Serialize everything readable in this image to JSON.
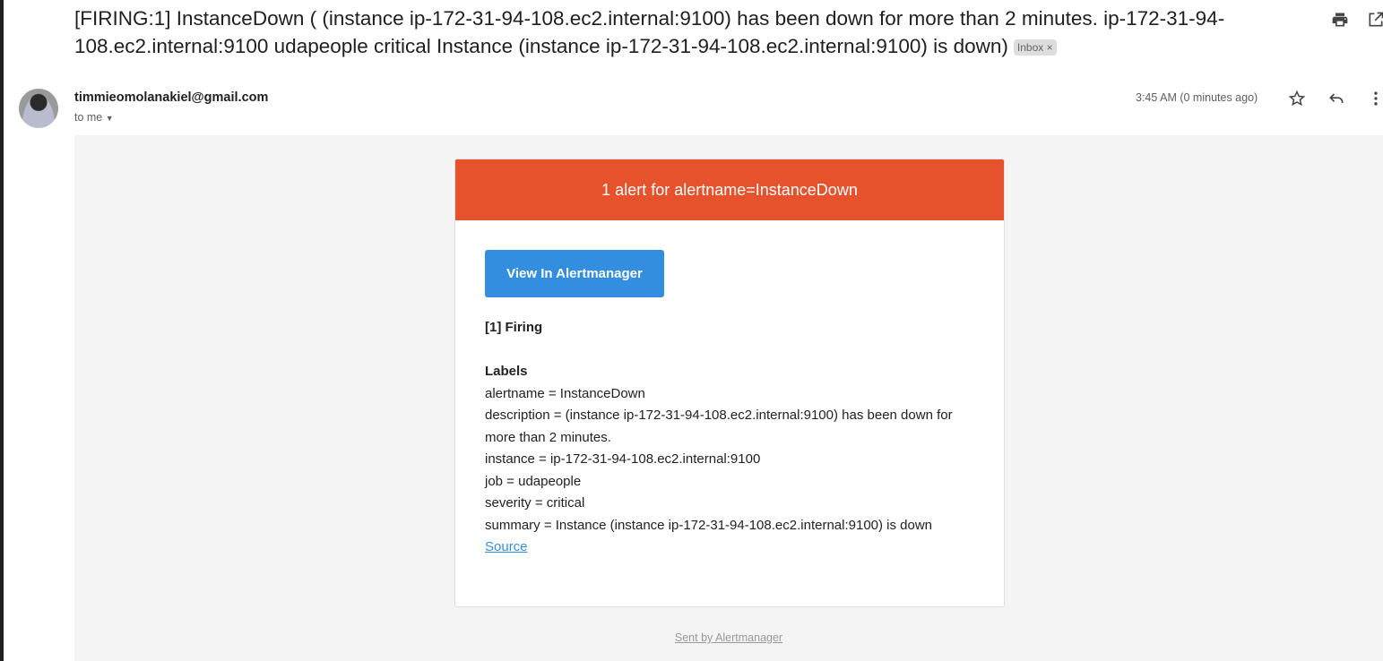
{
  "subject": "[FIRING:1] InstanceDown ( (instance ip-172-31-94-108.ec2.internal:9100) has been down for more than 2 minutes. ip-172-31-94-108.ec2.internal:9100 udapeople critical Instance (instance ip-172-31-94-108.ec2.internal:9100) is down)",
  "label_badge": "Inbox ×",
  "sender": "timmieomolanakiel@gmail.com",
  "recipient": "to me",
  "time": "3:45 AM (0 minutes ago)",
  "email": {
    "header": "1 alert for alertname=InstanceDown",
    "button": "View In Alertmanager",
    "firing": "[1] Firing",
    "labels_title": "Labels",
    "labels": [
      "alertname = InstanceDown",
      "description = (instance ip-172-31-94-108.ec2.internal:9100) has been down for more than 2 minutes.",
      "instance = ip-172-31-94-108.ec2.internal:9100",
      "job = udapeople",
      "severity = critical",
      "summary = Instance (instance ip-172-31-94-108.ec2.internal:9100) is down"
    ],
    "source": "Source",
    "footer": "Sent by Alertmanager"
  },
  "colors": {
    "header": "#e6522c",
    "button": "#348ee0"
  }
}
